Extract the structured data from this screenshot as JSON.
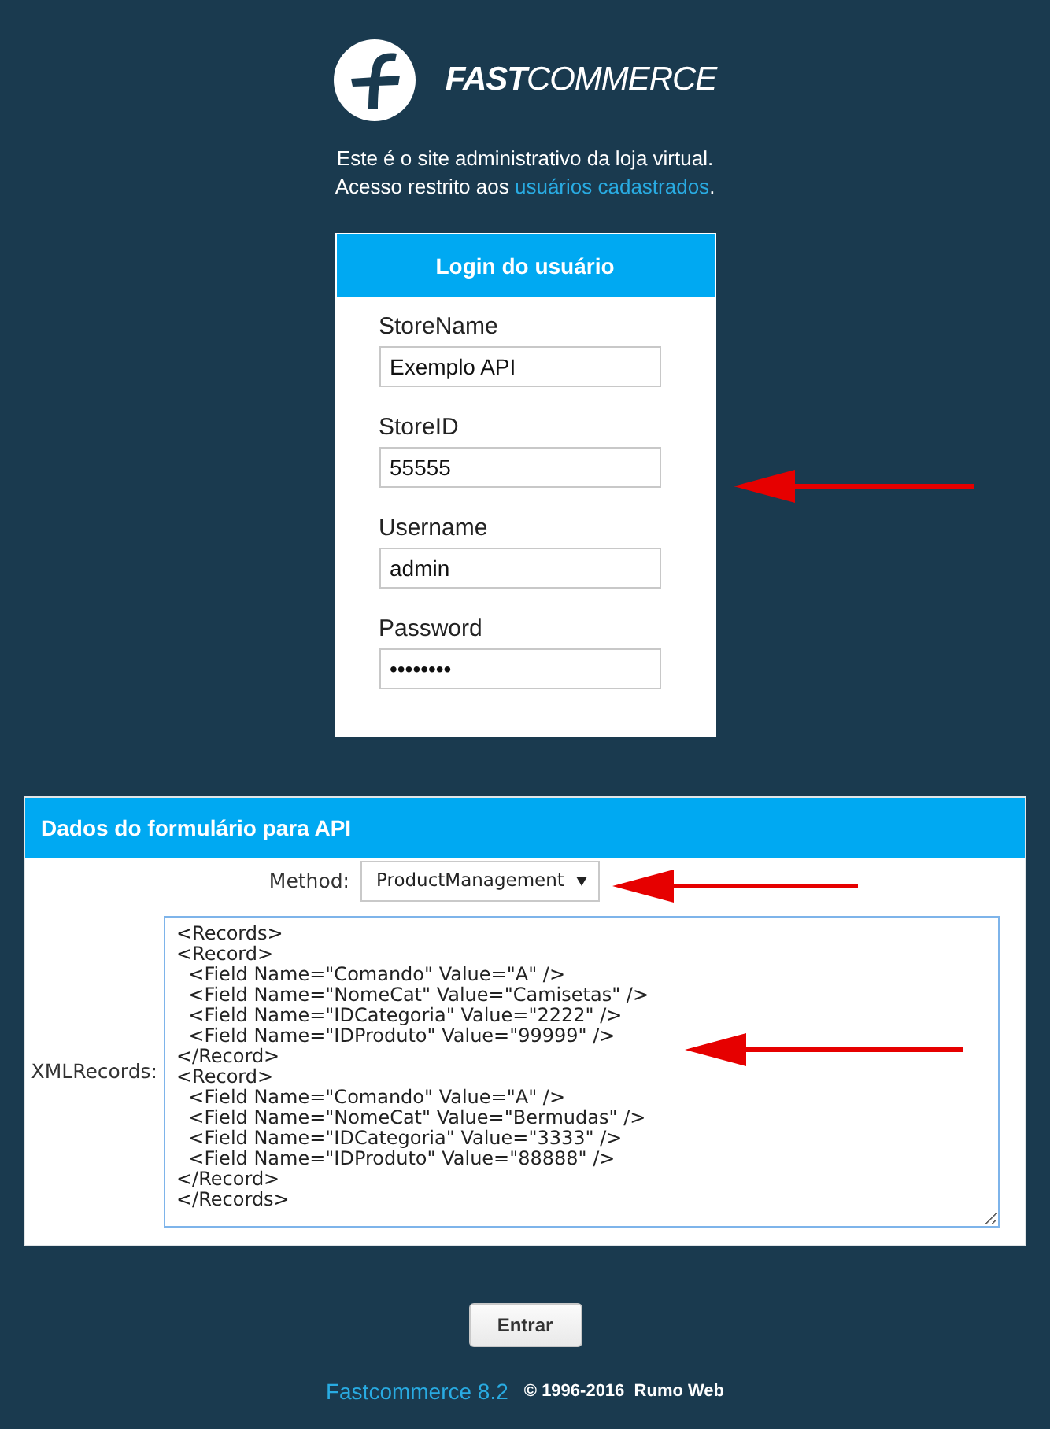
{
  "logo": {
    "wordmark_bold": "FAST",
    "wordmark_light": "COMMERCE"
  },
  "intro": {
    "line_1": "Este é o site administrativo da loja virtual.",
    "line_2": {
      "text_before": "Acesso restrito aos",
      "link": "usuários cadastrados",
      "text_after": "."
    }
  },
  "login_card": {
    "title": "Login do usuário",
    "fields": [
      {
        "label": "StoreName",
        "value": "Exemplo API",
        "kind": "text"
      },
      {
        "label": "StoreID",
        "value": "55555",
        "kind": "text"
      },
      {
        "label": "Username",
        "value": "admin",
        "kind": "text"
      },
      {
        "label": "Password",
        "value": "••••••••",
        "kind": "password"
      }
    ]
  },
  "api_form": {
    "title": "Dados do formulário para API",
    "method": {
      "label": "Method:",
      "value": "ProductManagement"
    },
    "xml_records": {
      "label": "XMLRecords:",
      "focused": true,
      "value": "<Records>\n<Record>\n  <Field Name=\"Comando\" Value=\"A\" />\n  <Field Name=\"NomeCat\" Value=\"Camisetas\" />\n  <Field Name=\"IDCategoria\" Value=\"2222\" />\n  <Field Name=\"IDProduto\" Value=\"99999\" />\n</Record>\n<Record>\n  <Field Name=\"Comando\" Value=\"A\" />\n  <Field Name=\"NomeCat\" Value=\"Bermudas\" />\n  <Field Name=\"IDCategoria\" Value=\"3333\" />\n  <Field Name=\"IDProduto\" Value=\"88888\" />\n</Record>\n</Records>"
    }
  },
  "submit_button": {
    "label": "Entrar"
  },
  "footer": {
    "product": "Fastcommerce 8.2",
    "copyright": "© 1996-2016  Rumo Web"
  }
}
